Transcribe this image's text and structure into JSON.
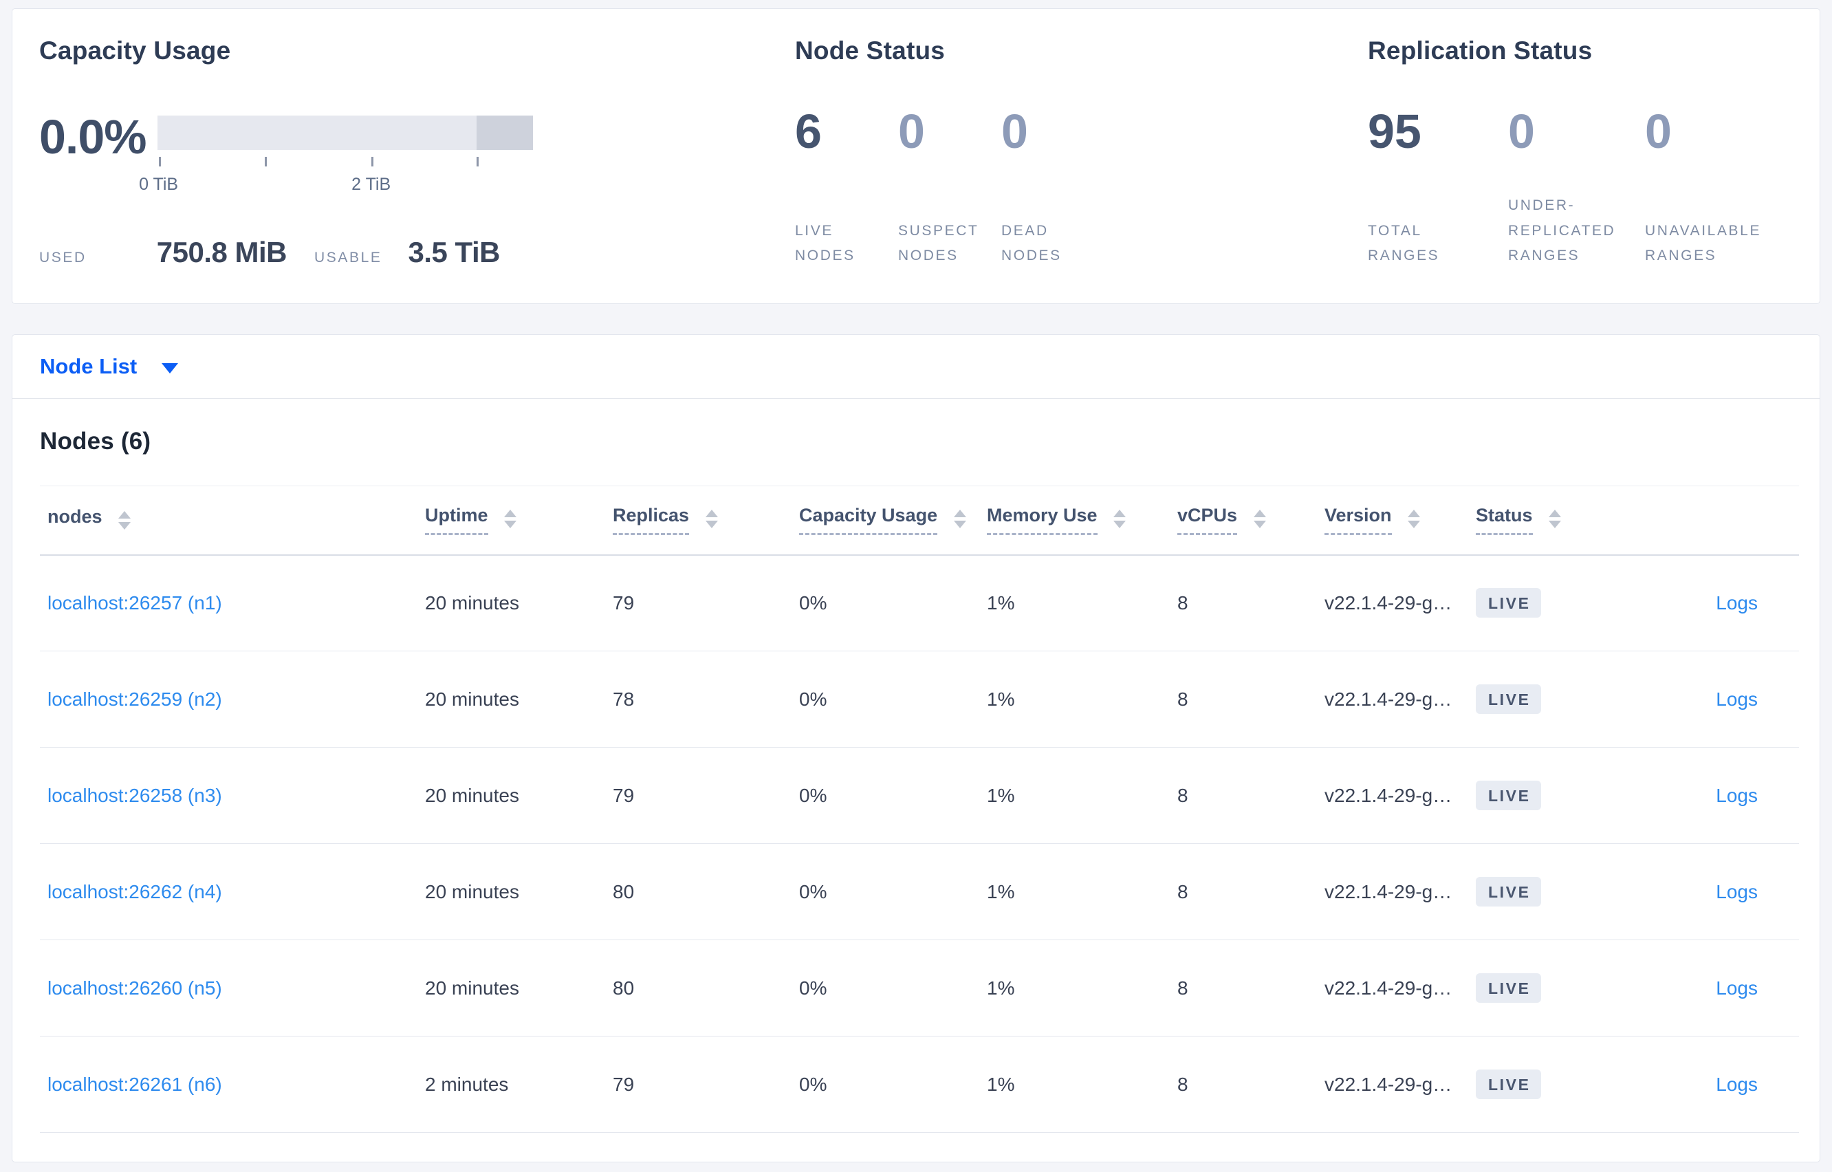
{
  "colors": {
    "accent_blue": "#0c5ef5",
    "link_blue": "#2e8bee",
    "page_bg": "#f4f5f9",
    "badge_bg": "#e8ecf3",
    "bar_light": "#e6e8ef",
    "bar_dark": "#ced2dc"
  },
  "capacity": {
    "title": "Capacity Usage",
    "percent": "0.0%",
    "axis": {
      "tick0_label": "0 TiB",
      "tick2_label": "2 TiB"
    },
    "used_label": "USED",
    "used_value": "750.8 MiB",
    "usable_label": "USABLE",
    "usable_value": "3.5 TiB"
  },
  "node_status": {
    "title": "Node Status",
    "stats": [
      {
        "value": "6",
        "label": "LIVE NODES"
      },
      {
        "value": "0",
        "label": "SUSPECT NODES"
      },
      {
        "value": "0",
        "label": "DEAD NODES"
      }
    ]
  },
  "replication_status": {
    "title": "Replication Status",
    "stats": [
      {
        "value": "95",
        "label": "TOTAL RANGES"
      },
      {
        "value": "0",
        "label": "UNDER-REPLICATED RANGES"
      },
      {
        "value": "0",
        "label": "UNAVAILABLE RANGES"
      }
    ]
  },
  "node_list": {
    "selector_label": "Node List",
    "heading": "Nodes (6)",
    "columns": [
      "nodes",
      "Uptime",
      "Replicas",
      "Capacity Usage",
      "Memory Use",
      "vCPUs",
      "Version",
      "Status"
    ],
    "rows": [
      {
        "node": "localhost:26257 (n1)",
        "uptime": "20 minutes",
        "replicas": "79",
        "capacity": "0%",
        "memory": "1%",
        "vcpus": "8",
        "version": "v22.1.4-29-g…",
        "status": "LIVE",
        "logs": "Logs"
      },
      {
        "node": "localhost:26259 (n2)",
        "uptime": "20 minutes",
        "replicas": "78",
        "capacity": "0%",
        "memory": "1%",
        "vcpus": "8",
        "version": "v22.1.4-29-g…",
        "status": "LIVE",
        "logs": "Logs"
      },
      {
        "node": "localhost:26258 (n3)",
        "uptime": "20 minutes",
        "replicas": "79",
        "capacity": "0%",
        "memory": "1%",
        "vcpus": "8",
        "version": "v22.1.4-29-g…",
        "status": "LIVE",
        "logs": "Logs"
      },
      {
        "node": "localhost:26262 (n4)",
        "uptime": "20 minutes",
        "replicas": "80",
        "capacity": "0%",
        "memory": "1%",
        "vcpus": "8",
        "version": "v22.1.4-29-g…",
        "status": "LIVE",
        "logs": "Logs"
      },
      {
        "node": "localhost:26260 (n5)",
        "uptime": "20 minutes",
        "replicas": "80",
        "capacity": "0%",
        "memory": "1%",
        "vcpus": "8",
        "version": "v22.1.4-29-g…",
        "status": "LIVE",
        "logs": "Logs"
      },
      {
        "node": "localhost:26261 (n6)",
        "uptime": "2 minutes",
        "replicas": "79",
        "capacity": "0%",
        "memory": "1%",
        "vcpus": "8",
        "version": "v22.1.4-29-g…",
        "status": "LIVE",
        "logs": "Logs"
      }
    ]
  }
}
